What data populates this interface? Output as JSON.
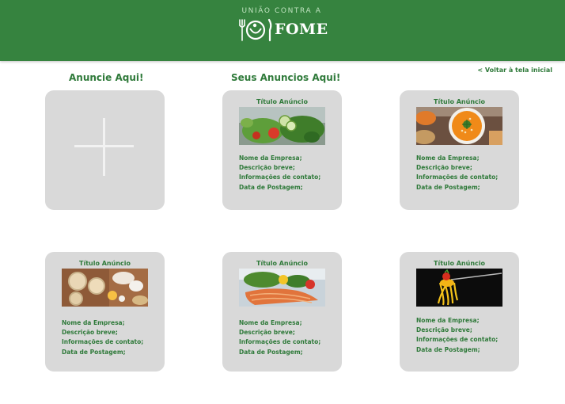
{
  "header": {
    "logo_top": "UNIÃO CONTRA A",
    "logo_word": "FOME"
  },
  "nav": {
    "back_link": "< Voltar à tela inicial"
  },
  "sections": {
    "advertise_heading": "Anuncie Aqui!",
    "my_ads_heading": "Seus Anuncios Aqui!"
  },
  "add_card": {
    "icon": "plus-icon"
  },
  "ads": [
    {
      "title": "Título Anúncio",
      "image": "salad-photo",
      "company": "Nome da Empresa;",
      "description": "Descrição breve;",
      "contact": "Informações de contato;",
      "date": "Data de Postagem;"
    },
    {
      "title": "Título Anúncio",
      "image": "soup-photo",
      "company": "Nome da Empresa;",
      "description": "Descrição breve;",
      "contact": "Informações de contato;",
      "date": "Data de Postagem;"
    },
    {
      "title": "Título Anúncio",
      "image": "pasta-ingredients-photo",
      "company": "Nome da Empresa;",
      "description": "Descrição breve;",
      "contact": "Informações de contato;",
      "date": "Data de Postagem;"
    },
    {
      "title": "Título Anúncio",
      "image": "salmon-photo",
      "company": "Nome da Empresa;",
      "description": "Descrição breve;",
      "contact": "Informações de contato;",
      "date": "Data de Postagem;"
    },
    {
      "title": "Título Anúncio",
      "image": "spaghetti-fork-photo",
      "company": "Nome da Empresa;",
      "description": "Descrição breve;",
      "contact": "Informações de contato;",
      "date": "Data de Postagem;"
    }
  ],
  "colors": {
    "brand_green": "#36833f",
    "text_green": "#2f7a3a",
    "card_gray": "#d9d9d9"
  }
}
